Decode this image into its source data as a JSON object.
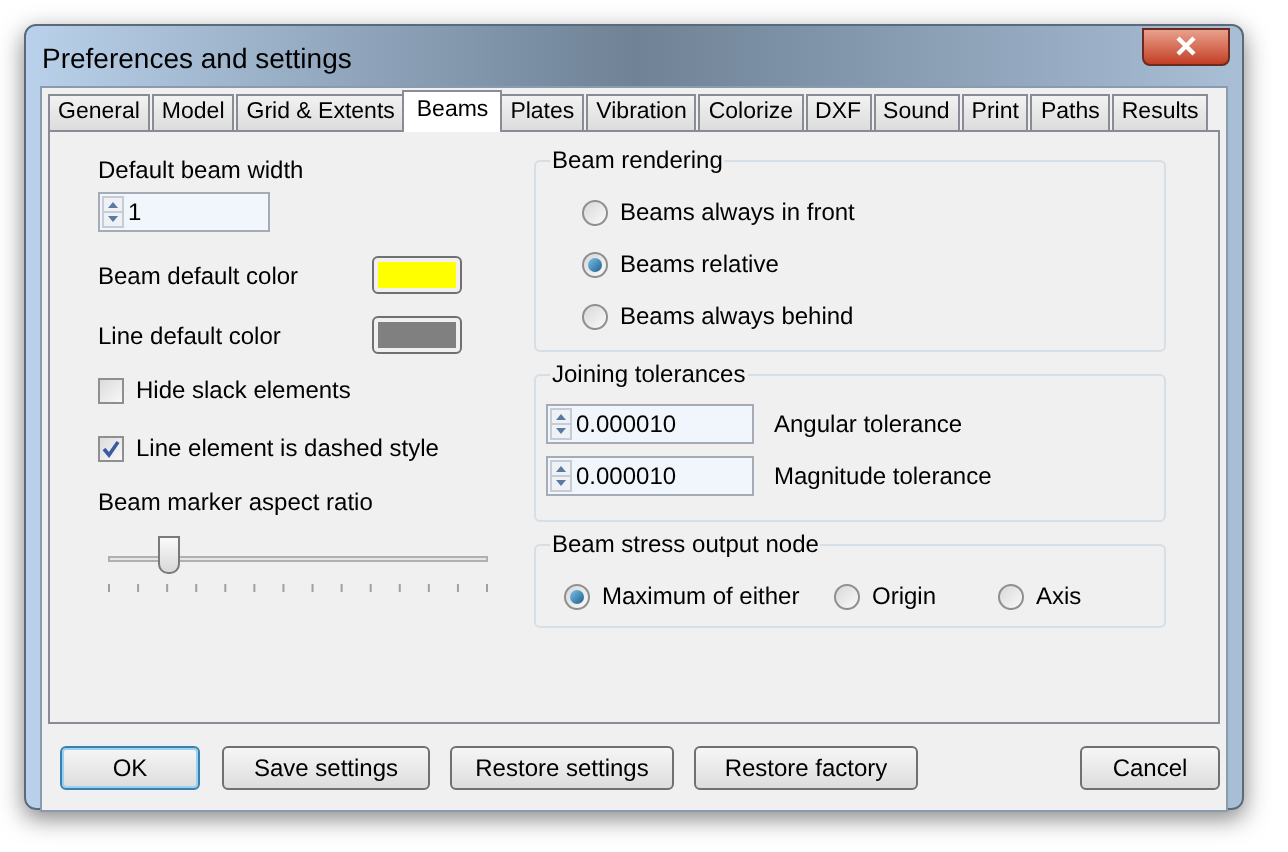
{
  "window": {
    "title": "Preferences and settings"
  },
  "tabs": [
    {
      "label": "General",
      "selected": false
    },
    {
      "label": "Model",
      "selected": false
    },
    {
      "label": "Grid & Extents",
      "selected": false
    },
    {
      "label": "Beams",
      "selected": true
    },
    {
      "label": "Plates",
      "selected": false
    },
    {
      "label": "Vibration",
      "selected": false
    },
    {
      "label": "Colorize",
      "selected": false
    },
    {
      "label": "DXF",
      "selected": false
    },
    {
      "label": "Sound",
      "selected": false
    },
    {
      "label": "Print",
      "selected": false
    },
    {
      "label": "Paths",
      "selected": false
    },
    {
      "label": "Results",
      "selected": false
    }
  ],
  "default_beam_width": {
    "label": "Default beam width",
    "value": "1"
  },
  "colors": [
    {
      "label": "Beam default color",
      "color": "#ffff00"
    },
    {
      "label": "Line default color",
      "color": "#808080"
    }
  ],
  "checkboxes": [
    {
      "label": "Hide slack elements",
      "checked": false
    },
    {
      "label": "Line element is dashed style",
      "checked": true
    }
  ],
  "aspect_ratio": {
    "label": "Beam marker aspect ratio",
    "level": 0.16
  },
  "beam_rendering": {
    "title": "Beam rendering",
    "options": [
      {
        "label": "Beams always in front",
        "selected": false
      },
      {
        "label": "Beams relative",
        "selected": true
      },
      {
        "label": "Beams always behind",
        "selected": false
      }
    ]
  },
  "joining_tolerances": {
    "title": "Joining tolerances",
    "fields": [
      {
        "value": "0.000010",
        "label": "Angular tolerance"
      },
      {
        "value": "0.000010",
        "label": "Magnitude tolerance"
      }
    ]
  },
  "beam_stress_output_node": {
    "title": "Beam stress output node",
    "options": [
      {
        "label": "Maximum of either",
        "selected": true
      },
      {
        "label": "Origin",
        "selected": false
      },
      {
        "label": "Axis",
        "selected": false
      }
    ]
  },
  "buttons": [
    "OK",
    "Save settings",
    "Restore settings",
    "Restore factory",
    "Cancel"
  ]
}
